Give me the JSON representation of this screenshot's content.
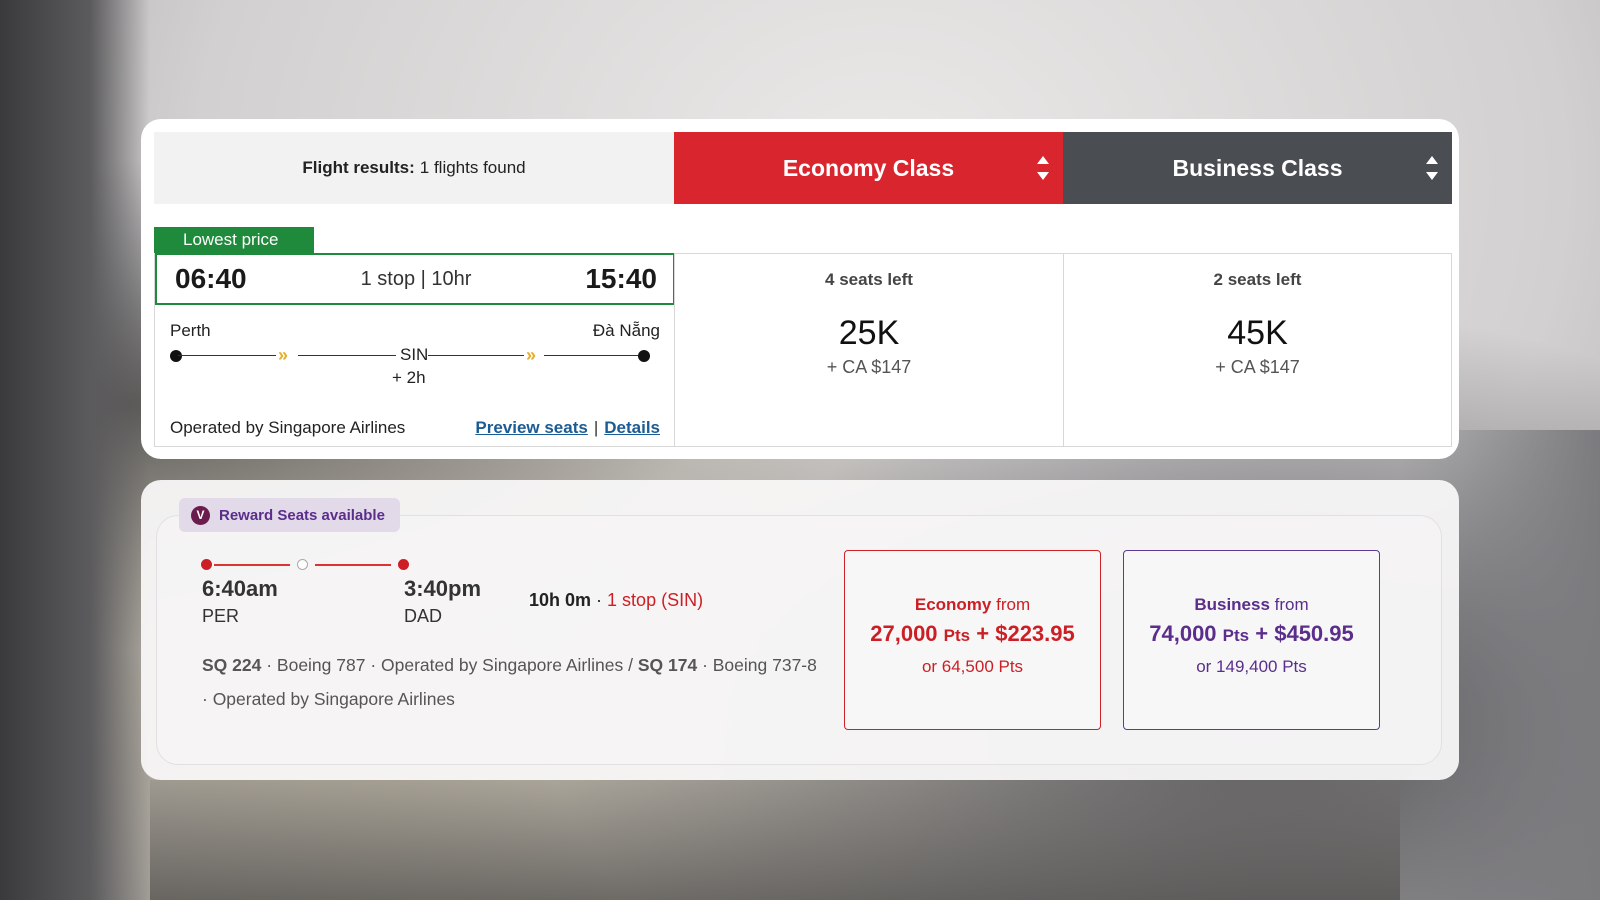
{
  "results_header": {
    "label": "Flight results:",
    "count_text": "1 flights found"
  },
  "classes": [
    {
      "label": "Economy Class",
      "color": "#d9262e"
    },
    {
      "label": "Business Class",
      "color": "#4a4d52"
    }
  ],
  "flight": {
    "badge": "Lowest price",
    "depart_time": "06:40",
    "stops_duration": "1 stop | 10hr",
    "arrive_time": "15:40",
    "origin": "Perth",
    "destination": "Đà Nẵng",
    "via": "SIN",
    "layover": "+ 2h",
    "operated_by": "Operated by Singapore Airlines",
    "preview_link": "Preview seats",
    "details_link": "Details",
    "link_separator": "|"
  },
  "fares": [
    {
      "seats_left": "4 seats left",
      "points": "25K",
      "cash": "+ CA $147"
    },
    {
      "seats_left": "2 seats left",
      "points": "45K",
      "cash": "+ CA $147"
    }
  ],
  "reward": {
    "badge_icon": "V",
    "badge_text": "Reward Seats available",
    "depart_time": "6:40am",
    "depart_code": "PER",
    "arrive_time": "3:40pm",
    "arrive_code": "DAD",
    "duration": "10h 0m",
    "separator": " · ",
    "stops": "1 stop (SIN)",
    "segment1_flight": "SQ 224",
    "segment1_info": " · Boeing 787 · Operated by Singapore Airlines / ",
    "segment2_flight": "SQ 174",
    "segment2_info": " · Boeing 737-8 · Operated by Singapore Airlines",
    "offers": [
      {
        "cabin": "Economy",
        "from": "from",
        "points": "27,000",
        "unit": "Pts",
        "cash": "+ $223.95",
        "alt": "or 64,500 Pts",
        "color": "#cc1f25"
      },
      {
        "cabin": "Business",
        "from": "from",
        "points": "74,000",
        "unit": "Pts",
        "cash": "+ $450.95",
        "alt": "or 149,400 Pts",
        "color": "#5b2e8c"
      }
    ]
  }
}
